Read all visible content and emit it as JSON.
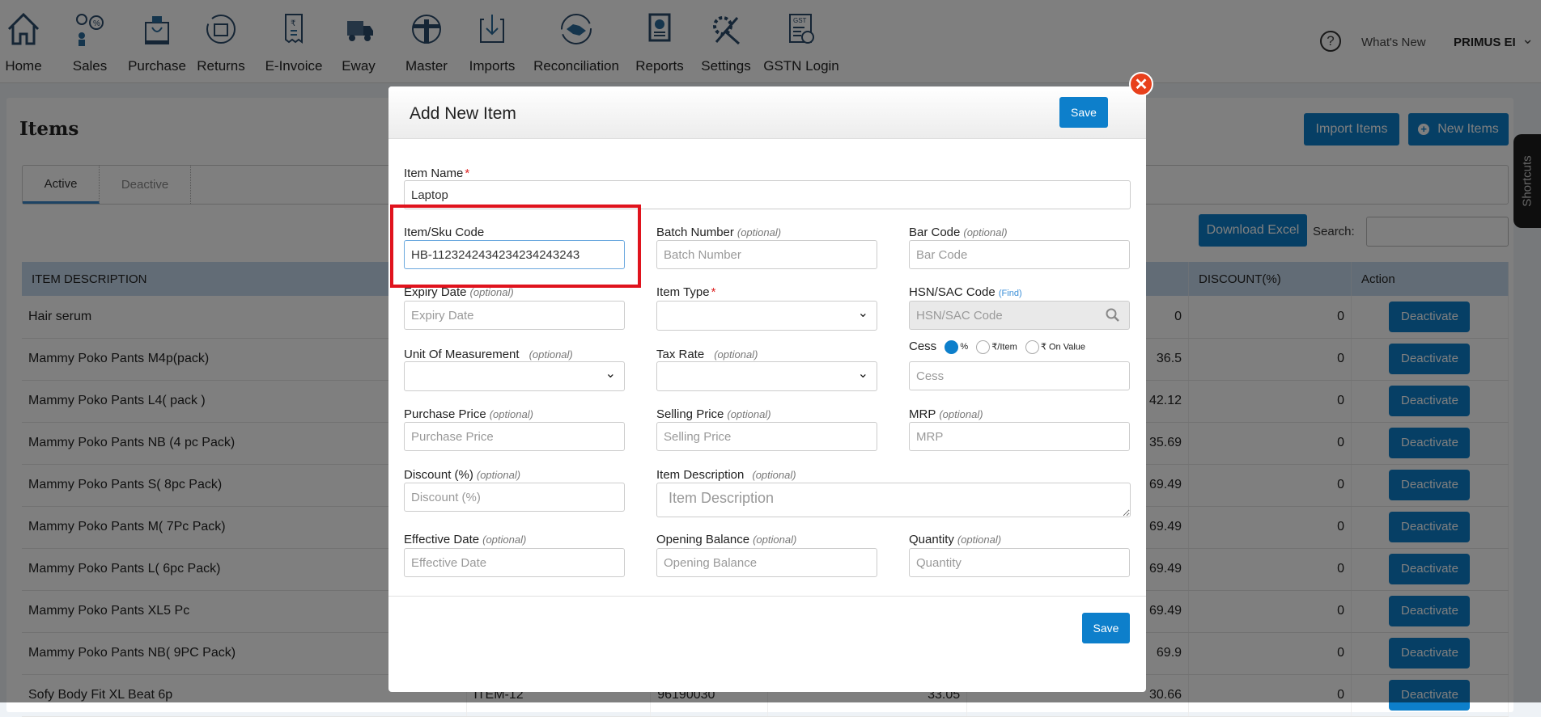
{
  "nav": {
    "items": [
      {
        "label": "Home",
        "icon": "home-icon"
      },
      {
        "label": "Sales",
        "icon": "sales-icon"
      },
      {
        "label": "Purchase",
        "icon": "purchase-bag-icon"
      },
      {
        "label": "Returns",
        "icon": "returns-icon"
      },
      {
        "label": "E-Invoice",
        "icon": "invoice-icon"
      },
      {
        "label": "Eway",
        "icon": "truck-icon"
      },
      {
        "label": "Master",
        "icon": "master-icon"
      },
      {
        "label": "Imports",
        "icon": "import-icon"
      },
      {
        "label": "Reconciliation",
        "icon": "handshake-icon"
      },
      {
        "label": "Reports",
        "icon": "reports-icon"
      },
      {
        "label": "Settings",
        "icon": "settings-tools-icon"
      },
      {
        "label": "GSTN Login",
        "icon": "gst-icon"
      }
    ],
    "help_icon": "question-circle-icon",
    "whats_new": "What's New",
    "user": "PRIMUS EI"
  },
  "page": {
    "title": "Items",
    "import_items": "Import Items",
    "new_items": "New Items",
    "tabs": [
      "Active",
      "Deactive"
    ],
    "download_excel": "Download Excel",
    "search_label": "Search:",
    "shortcuts": "Shortcuts"
  },
  "table": {
    "headers": [
      "ITEM DESCRIPTION",
      "",
      "",
      "",
      "",
      "DISCOUNT(%)",
      "Action"
    ],
    "rows": [
      [
        "Hair serum",
        "",
        "",
        "",
        "0",
        "0",
        "Deactivate"
      ],
      [
        "Mammy Poko Pants M4p(pack)",
        "",
        "",
        "",
        "36.5",
        "0",
        "Deactivate"
      ],
      [
        "Mammy Poko Pants L4( pack )",
        "",
        "",
        "",
        "42.12",
        "0",
        "Deactivate"
      ],
      [
        "Mammy Poko Pants NB (4 pc Pack)",
        "",
        "",
        "",
        "35.69",
        "0",
        "Deactivate"
      ],
      [
        "Mammy Poko Pants S( 8pc Pack)",
        "",
        "",
        "",
        "69.49",
        "0",
        "Deactivate"
      ],
      [
        "Mammy Poko Pants M( 7Pc Pack)",
        "",
        "",
        "",
        "69.49",
        "0",
        "Deactivate"
      ],
      [
        "Mammy Poko Pants L( 6pc Pack)",
        "",
        "",
        "",
        "69.49",
        "0",
        "Deactivate"
      ],
      [
        "Mammy Poko Pants XL5 Pc",
        "",
        "",
        "",
        "69.49",
        "0",
        "Deactivate"
      ],
      [
        "Mammy Poko Pants NB( 9PC Pack)",
        "",
        "",
        "",
        "69.9",
        "0",
        "Deactivate"
      ],
      [
        "Sofy Body Fit XL Beat 6p",
        "ITEM-12",
        "96190030",
        "33.05",
        "30.66",
        "0",
        "Deactivate"
      ]
    ]
  },
  "modal": {
    "title": "Add New Item",
    "save": "Save",
    "optional": "(optional)",
    "required_mark": "*",
    "item_name": {
      "label": "Item Name",
      "value": "Laptop"
    },
    "sku": {
      "label": "Item/Sku Code",
      "value": "HB-1123242434234234243243"
    },
    "batch": {
      "label": "Batch Number",
      "placeholder": "Batch Number"
    },
    "barcode": {
      "label": "Bar Code",
      "placeholder": "Bar Code"
    },
    "expiry": {
      "label": "Expiry Date",
      "placeholder": "Expiry Date"
    },
    "item_type": {
      "label": "Item Type",
      "value": ""
    },
    "hsn": {
      "label": "HSN/SAC Code",
      "find": "(Find)",
      "placeholder": "HSN/SAC Code"
    },
    "uom": {
      "label": "Unit Of Measurement",
      "value": ""
    },
    "tax_rate": {
      "label": "Tax Rate",
      "value": ""
    },
    "cess": {
      "label": "Cess",
      "options": [
        "%",
        "₹/Item",
        "₹ On Value"
      ],
      "selected": "%",
      "placeholder": "Cess"
    },
    "purchase_price": {
      "label": "Purchase Price",
      "placeholder": "Purchase Price"
    },
    "selling_price": {
      "label": "Selling Price",
      "placeholder": "Selling Price"
    },
    "mrp": {
      "label": "MRP",
      "placeholder": "MRP"
    },
    "discount": {
      "label": "Discount (%)",
      "placeholder": "Discount (%)"
    },
    "description": {
      "label": "Item Description",
      "placeholder": "Item Description"
    },
    "effective_date": {
      "label": "Effective Date",
      "placeholder": "Effective Date"
    },
    "opening_balance": {
      "label": "Opening Balance",
      "placeholder": "Opening Balance"
    },
    "quantity": {
      "label": "Quantity",
      "placeholder": "Quantity"
    }
  },
  "colors": {
    "primary": "#0d7fcb",
    "close": "#e8401c",
    "highlight": "#e0131d"
  }
}
